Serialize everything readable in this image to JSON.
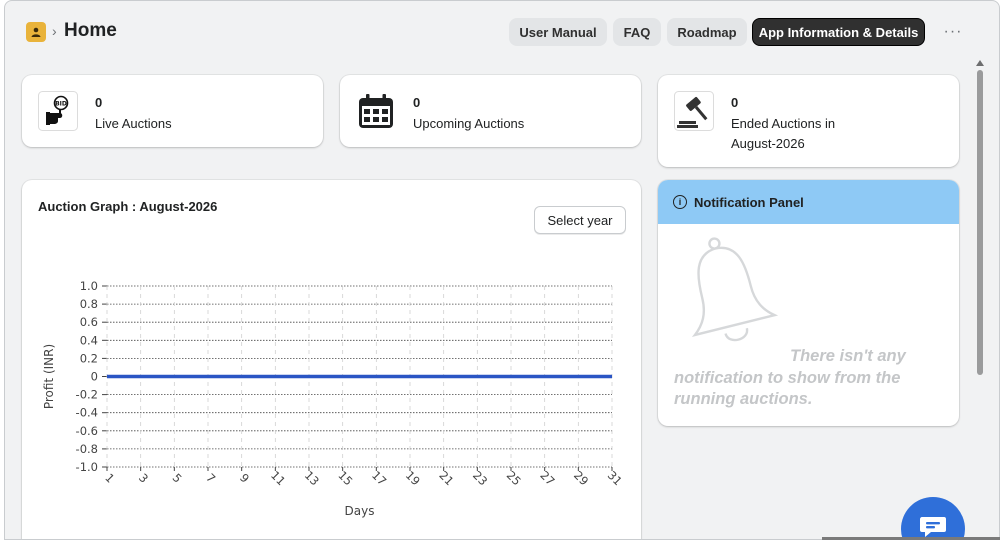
{
  "header": {
    "title": "Home",
    "breadcrumb_separator": "›",
    "buttons": {
      "user_manual": "User Manual",
      "faq": "FAQ",
      "roadmap": "Roadmap",
      "app_info": "App Information & Details"
    },
    "more_label": "···"
  },
  "stats": {
    "live": {
      "count": "0",
      "label": "Live Auctions",
      "icon": "bid-hand-icon"
    },
    "upcoming": {
      "count": "0",
      "label": "Upcoming Auctions",
      "icon": "calendar-icon"
    },
    "ended": {
      "count": "0",
      "label_line1": "Ended Auctions in",
      "label_line2": "August-2026",
      "icon": "gavel-icon"
    }
  },
  "graph": {
    "title": "Auction Graph : August-2026",
    "select_label": "Select year"
  },
  "notifications": {
    "title": "Notification Panel",
    "empty_text": "There isn't any notification to show from the running auctions."
  },
  "chart_data": {
    "type": "line",
    "title": "",
    "xlabel": "Days",
    "ylabel": "Profit (INR)",
    "x": [
      1,
      2,
      3,
      4,
      5,
      6,
      7,
      8,
      9,
      10,
      11,
      12,
      13,
      14,
      15,
      16,
      17,
      18,
      19,
      20,
      21,
      22,
      23,
      24,
      25,
      26,
      27,
      28,
      29,
      30,
      31
    ],
    "x_tick_labels": [
      "1",
      "3",
      "5",
      "7",
      "9",
      "11",
      "13",
      "15",
      "17",
      "19",
      "21",
      "23",
      "25",
      "27",
      "29",
      "31"
    ],
    "y_tick_labels": [
      "1.0",
      "0.8",
      "0.6",
      "0.4",
      "0.2",
      "0",
      "-0.2",
      "-0.4",
      "-0.6",
      "-0.8",
      "-1.0"
    ],
    "ylim": [
      -1.0,
      1.0
    ],
    "grid": true,
    "series": [
      {
        "values": [
          0,
          0,
          0,
          0,
          0,
          0,
          0,
          0,
          0,
          0,
          0,
          0,
          0,
          0,
          0,
          0,
          0,
          0,
          0,
          0,
          0,
          0,
          0,
          0,
          0,
          0,
          0,
          0,
          0,
          0,
          0
        ],
        "color": "#2a55c4"
      }
    ]
  },
  "colors": {
    "line": "#2a55c4",
    "notif_header": "#8ec9f5",
    "fab": "#2f6fd9",
    "logo": "#e9b33a"
  }
}
